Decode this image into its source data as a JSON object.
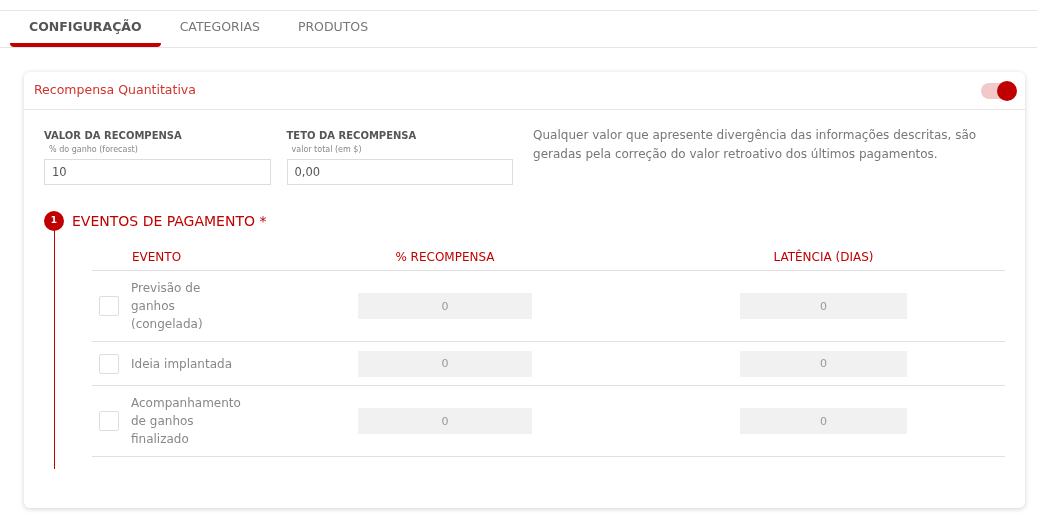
{
  "tabs": [
    {
      "label": "CONFIGURAÇÃO",
      "selected": true
    },
    {
      "label": "CATEGORIAS",
      "selected": false
    },
    {
      "label": "PRODUTOS",
      "selected": false
    }
  ],
  "card": {
    "title": "Recompensa Quantitativa",
    "enabled": true
  },
  "fields": [
    {
      "label": "VALOR DA RECOMPENSA",
      "hint": "% do ganho (forecast)",
      "value": "10"
    },
    {
      "label": "TETO DA RECOMPENSA",
      "hint": "valor total (em $)",
      "value": "0,00"
    }
  ],
  "note": "Qualquer valor que apresente divergência das informações descritas, são geradas pela correção do valor retroativo dos últimos pagamentos.",
  "section": {
    "number": "1",
    "title": "EVENTOS DE PAGAMENTO *"
  },
  "table": {
    "columns": [
      "EVENTO",
      "% RECOMPENSA",
      "LATÊNCIA (DIAS)"
    ],
    "rows": [
      {
        "event": "Previsão de ganhos (congelada)",
        "checked": false,
        "reward": "0",
        "latency": "0"
      },
      {
        "event": "Ideia implantada",
        "checked": false,
        "reward": "0",
        "latency": "0"
      },
      {
        "event": "Acompanhamento de ganhos finalizado",
        "checked": false,
        "reward": "0",
        "latency": "0"
      }
    ]
  }
}
